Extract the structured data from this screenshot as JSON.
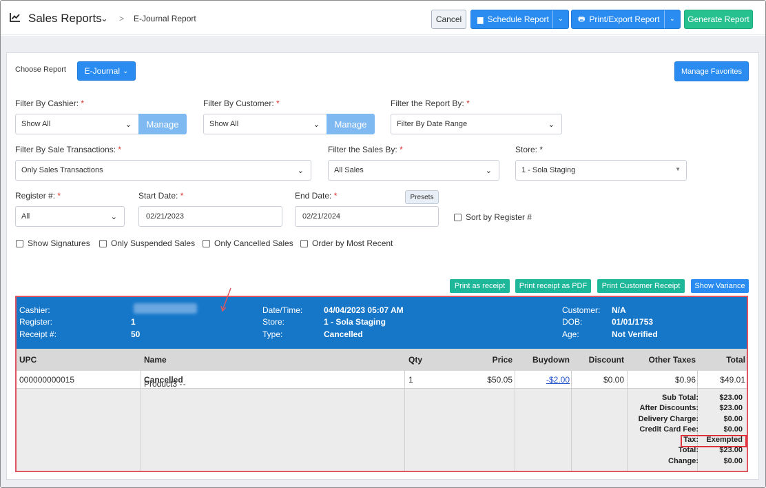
{
  "header": {
    "title": "Sales Reports",
    "breadcrumb_sep": ">",
    "breadcrumb": "E-Journal Report",
    "cancel_label": "Cancel",
    "schedule_label": "Schedule Report",
    "print_export_label": "Print/Export Report",
    "generate_label": "Generate Report"
  },
  "choose_report": {
    "label": "Choose Report",
    "value": "E-Journal",
    "manage_favorites": "Manage Favorites"
  },
  "filters": {
    "cashier": {
      "label": "Filter By Cashier:",
      "value": "Show All",
      "manage": "Manage"
    },
    "customer": {
      "label": "Filter By Customer:",
      "value": "Show All",
      "manage": "Manage"
    },
    "report_by": {
      "label": "Filter the Report By:",
      "value": "Filter By Date Range"
    },
    "sale_transactions": {
      "label": "Filter By Sale Transactions:",
      "value": "Only Sales Transactions"
    },
    "sales_by": {
      "label": "Filter the Sales By:",
      "value": "All Sales"
    },
    "store": {
      "label": "Store:",
      "required_mark": "*",
      "value": "1 - Sola Staging"
    },
    "register": {
      "label": "Register #:",
      "value": "All"
    },
    "start_date": {
      "label": "Start Date:",
      "value": "02/21/2023"
    },
    "end_date": {
      "label": "End Date:",
      "value": "02/21/2024",
      "presets": "Presets"
    },
    "sort_by_register": "Sort by Register #",
    "show_signatures": "Show Signatures",
    "only_suspended": "Only Suspended Sales",
    "only_cancelled": "Only Cancelled Sales",
    "order_recent": "Order by Most Recent",
    "required": "*"
  },
  "actions": {
    "print_receipt": "Print as receipt",
    "print_pdf": "Print receipt as PDF",
    "print_customer": "Print Customer Receipt",
    "show_variance": "Show Variance"
  },
  "receipt": {
    "cashier_label": "Cashier:",
    "register_label": "Register:",
    "register_value": "1",
    "receipt_label": "Receipt #:",
    "receipt_value": "50",
    "datetime_label": "Date/Time:",
    "datetime_value": "04/04/2023 05:07 AM",
    "store_label": "Store:",
    "store_value": "1 - Sola Staging",
    "type_label": "Type:",
    "type_value": "Cancelled",
    "customer_label": "Customer:",
    "customer_value": "N/A",
    "dob_label": "DOB:",
    "dob_value": "01/01/1753",
    "age_label": "Age:",
    "age_value": "Not Verified",
    "columns": [
      "UPC",
      "Name",
      "Qty",
      "Price",
      "Buydown",
      "Discount",
      "Other Taxes",
      "Total"
    ],
    "row": {
      "upc": "000000000015",
      "name": "Product3 - ",
      "status": "Cancelled",
      "name_suffix": " -",
      "qty": "1",
      "price": "$50.05",
      "buydown": "-$2.00",
      "discount": "$0.00",
      "other_taxes": "$0.96",
      "total": "$49.01"
    },
    "totals": [
      {
        "label": "Sub Total:",
        "value": "$23.00"
      },
      {
        "label": "After Discounts:",
        "value": "$23.00"
      },
      {
        "label": "Delivery Charge:",
        "value": "$0.00"
      },
      {
        "label": "Credit Card Fee:",
        "value": "$0.00"
      },
      {
        "label": "Tax:",
        "value": "Exempted"
      },
      {
        "label": "Total:",
        "value": "$23.00"
      },
      {
        "label": "Change:",
        "value": "$0.00"
      }
    ]
  },
  "colors": {
    "primary": "#2a8cf0",
    "success": "#27c08f",
    "teal": "#1fb79a",
    "receipt_header": "#1677c9",
    "highlight": "#e0303a"
  }
}
